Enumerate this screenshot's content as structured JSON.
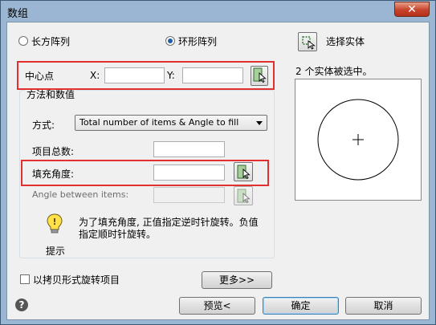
{
  "window": {
    "title": "数组",
    "close_glyph": "✕"
  },
  "array_type": {
    "rect_label": "长方阵列",
    "polar_label": "环形阵列",
    "selected": "polar"
  },
  "select_objects": {
    "label": "选择实体",
    "status": "2 个实体被选中。"
  },
  "center_point": {
    "label": "中心点",
    "x_label": "X:",
    "x_value": "",
    "y_label": "Y:",
    "y_value": ""
  },
  "method": {
    "group_label": "方法和数值",
    "method_label": "方式:",
    "method_value": "Total number of items & Angle to fill",
    "total_items_label": "项目总数:",
    "total_items_value": "",
    "fill_angle_label": "填充角度:",
    "fill_angle_value": "",
    "between_label": "Angle between items:",
    "between_value": ""
  },
  "tip": {
    "label": "提示",
    "text_line1": "为了填充角度, 正值指定逆时针旋转。负值",
    "text_line2": "指定顺时针旋转。"
  },
  "rotate_copy": {
    "label": "以拷贝形式旋转项目",
    "checked": false
  },
  "buttons": {
    "more": "更多>>",
    "preview": "预览<",
    "ok": "确定",
    "cancel": "取消",
    "help_glyph": "?"
  },
  "colors": {
    "highlight_box": "#e03030",
    "title_bar": "#9ab6d2",
    "close_button": "#c8432b"
  }
}
